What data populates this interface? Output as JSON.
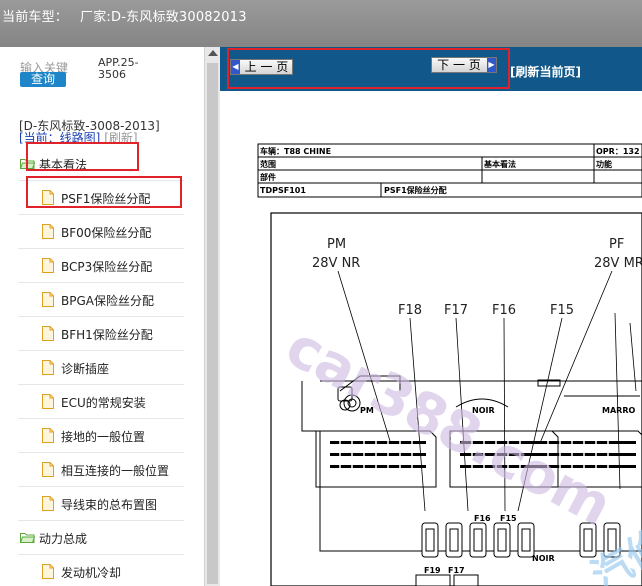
{
  "header": {
    "label": "当前车型：",
    "value": "厂家:D-东风标致30082013",
    "extra": "."
  },
  "sidebar": {
    "keyword_label": "输入关键",
    "search_button": "查询",
    "app_id_lines": [
      "APP.25-",
      "3506"
    ],
    "vehicle": "[D-东风标致-3008-2013]",
    "current_label": "[当前：线路图]",
    "refresh_label": "[刷新]",
    "tree": [
      {
        "type": "category",
        "label": "基本看法"
      },
      {
        "type": "leaf",
        "label": "PSF1保险丝分配"
      },
      {
        "type": "leaf",
        "label": "BF00保险丝分配"
      },
      {
        "type": "leaf",
        "label": "BCP3保险丝分配"
      },
      {
        "type": "leaf",
        "label": "BPGA保险丝分配"
      },
      {
        "type": "leaf",
        "label": "BFH1保险丝分配"
      },
      {
        "type": "leaf",
        "label": "诊断插座"
      },
      {
        "type": "leaf",
        "label": "ECU的常规安装"
      },
      {
        "type": "leaf",
        "label": "接地的一般位置"
      },
      {
        "type": "leaf",
        "label": "相互连接的一般位置"
      },
      {
        "type": "leaf",
        "label": "导线束的总布置图"
      },
      {
        "type": "category",
        "label": "动力总成"
      },
      {
        "type": "leaf",
        "label": "发动机冷却"
      }
    ]
  },
  "toolbar": {
    "prev_label": "上 一 页",
    "next_label": "下 一 页",
    "refresh_label": "[刷新当前页]"
  },
  "document": {
    "vehicle_label": "车辆：T88 CHINE",
    "opr_label": "OPR：132",
    "scope_label": "范围",
    "basic_label": "基本看法",
    "function_label": "功能",
    "part_label": "部件",
    "code": "TDPSF101",
    "title": "PSF1保险丝分配",
    "pm_label": "PM",
    "pm_volt": "28V NR",
    "pf_label": "PF",
    "pf_volt": "28V MR",
    "fuse_labels": [
      "F18",
      "F17",
      "F16",
      "F15"
    ],
    "small_pm": "PM",
    "noir_top": "NOIR",
    "marron": "MARRO",
    "f16_small": "F16",
    "f15_small": "F15",
    "noir_bottom": "NOIR",
    "f19_small": "F19",
    "f17_small": "F17",
    "watermark": "car388.com",
    "watermark_tail": "汽修"
  },
  "colors": {
    "toolbar": "#115789",
    "highlight": "#e0232b",
    "search": "#1e86c8",
    "topbar": "#8f8f8f"
  }
}
